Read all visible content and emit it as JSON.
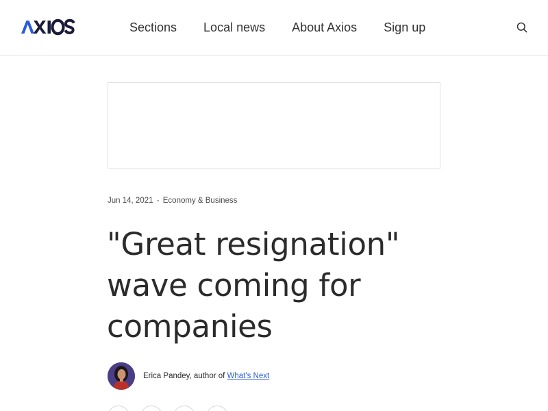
{
  "header": {
    "logo": "AXIOS",
    "nav": [
      {
        "label": "Sections"
      },
      {
        "label": "Local news"
      },
      {
        "label": "About Axios"
      },
      {
        "label": "Sign up"
      }
    ],
    "search_icon": "search-icon"
  },
  "article": {
    "date": "Jun 14, 2021",
    "separator": "-",
    "category": "Economy & Business",
    "headline": "\"Great resignation\" wave coming for companies",
    "author_name": "Erica Pandey, author of",
    "author_link": "What's Next"
  },
  "share_icons": [
    "share-icon-1",
    "share-icon-2",
    "share-icon-3",
    "share-icon-4"
  ],
  "colors": {
    "brand_blue": "#2a5bd7",
    "logo_dark": "#1b1b3a",
    "text": "#2b2b2b",
    "border": "#e2e2e2"
  }
}
